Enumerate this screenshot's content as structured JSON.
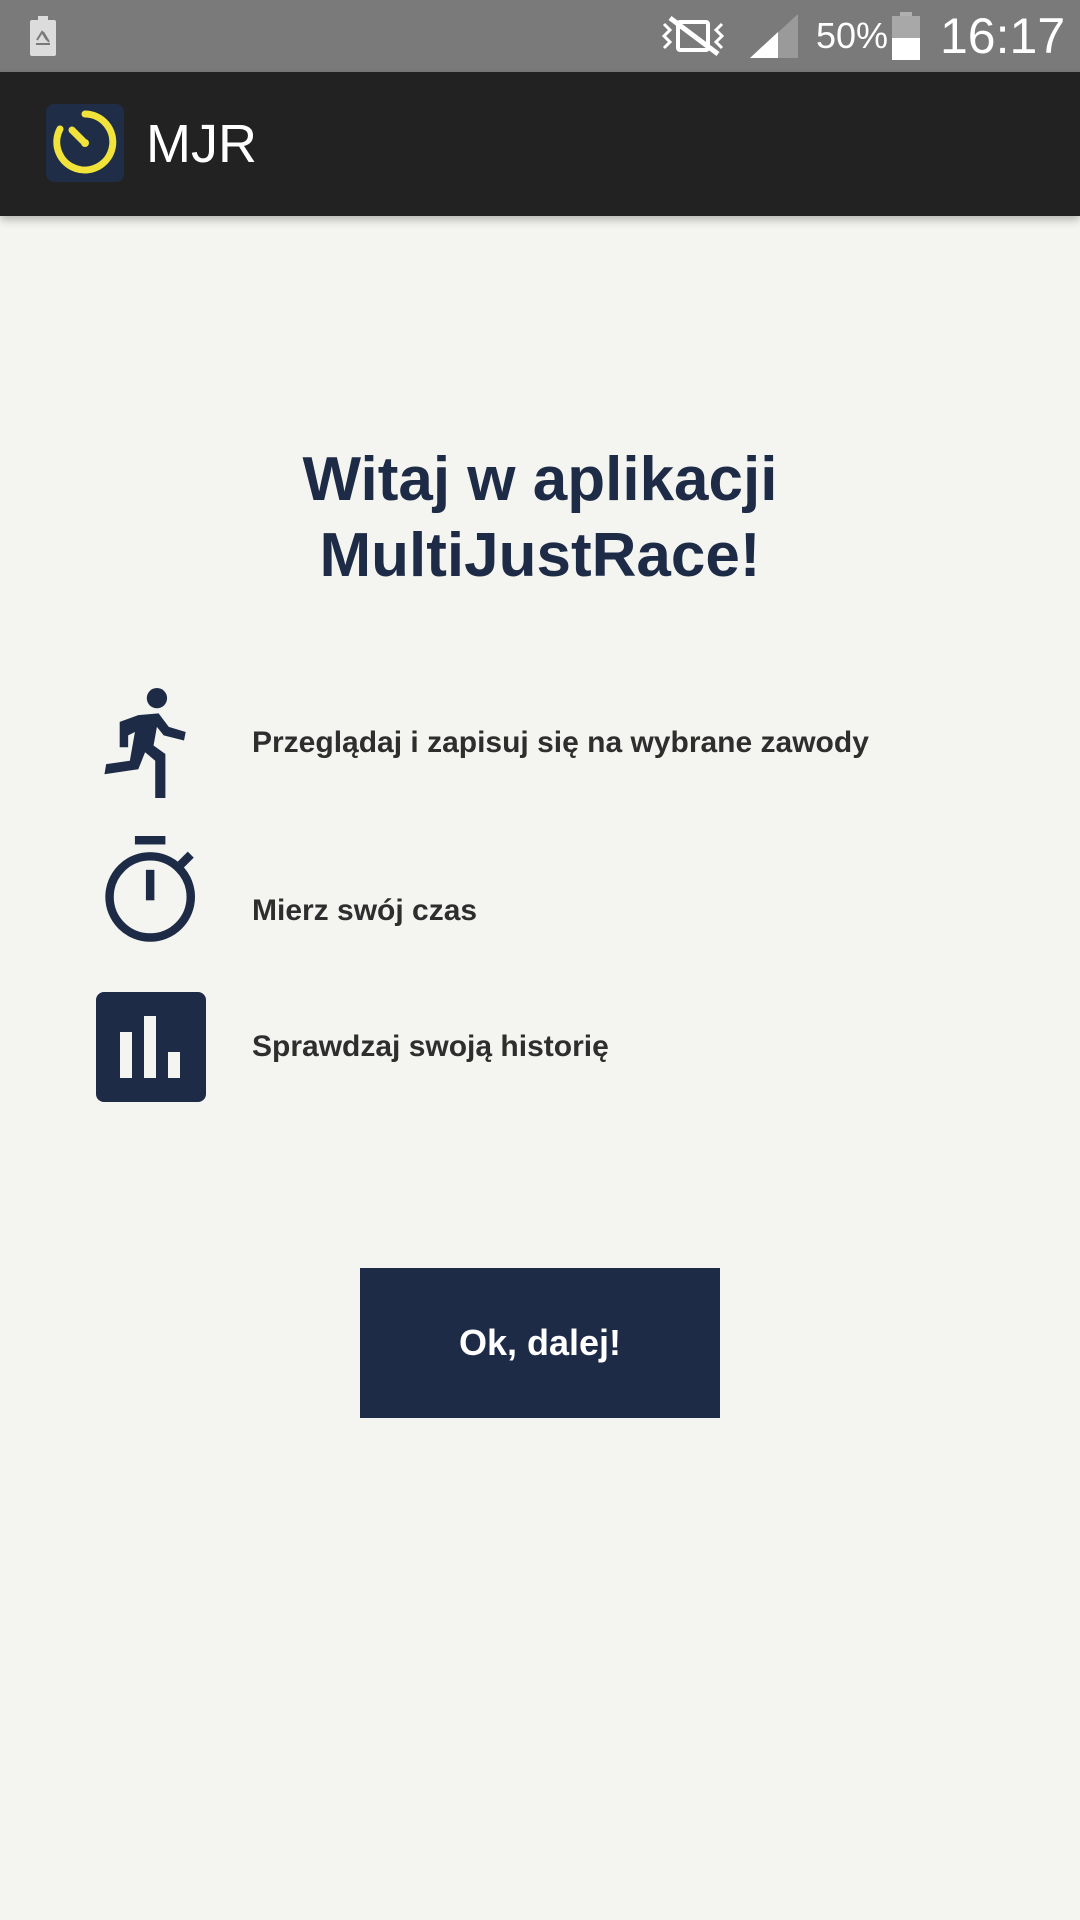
{
  "status_bar": {
    "battery_percent": "50%",
    "battery_level": 0.5,
    "time": "16:17",
    "icons": [
      "recycle-battery-icon",
      "vibrate-mute-icon",
      "signal-icon",
      "battery-icon"
    ]
  },
  "app_bar": {
    "title": "MJR",
    "logo_icon": "stopwatch-logo-icon",
    "background": "#222222"
  },
  "welcome": {
    "line1": "Witaj w aplikacji",
    "line2": "MultiJustRace!"
  },
  "features": [
    {
      "icon": "running-person-icon",
      "label": "Przeglądaj i zapisuj się na wybrane zawody"
    },
    {
      "icon": "stopwatch-icon",
      "label": "Mierz swój czas"
    },
    {
      "icon": "bar-chart-icon",
      "label": "Sprawdzaj swoją historię"
    }
  ],
  "button": {
    "label": "Ok, dalej!"
  },
  "colors": {
    "primary": "#1d2b47",
    "accent": "#f2e33b",
    "background": "#f4f4f0",
    "status_bar": "#7a7a7a"
  }
}
